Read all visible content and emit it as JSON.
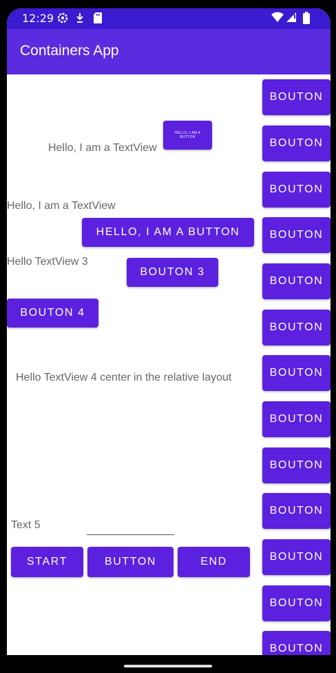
{
  "status_bar": {
    "time": "12:29",
    "left_icons": [
      "settings-gear-icon",
      "download-icon",
      "sd-card-icon"
    ],
    "right_icons": [
      "wifi-icon",
      "signal-icon",
      "battery-icon"
    ]
  },
  "app_bar": {
    "title": "Containers App"
  },
  "views": {
    "small_button": "HELLO, I AM A BUTTON",
    "textview_1": "Hello, I am a TextView",
    "textview_2": "Hello, I am a TextView",
    "hello_button": "HELLO, I AM A BUTTON",
    "textview_3": "Hello TextView 3",
    "bouton_3": "BOUTON 3",
    "bouton_4": "BOUTON 4",
    "textview_4": "Hello TextView 4 center in the relative layout",
    "text_5": "Text 5",
    "edit_text_value": "",
    "start_button": "START",
    "button_button": "BUTTON",
    "end_button": "END"
  },
  "side_buttons": [
    "BOUTON",
    "BOUTON",
    "BOUTON",
    "BOUTON",
    "BOUTON",
    "BOUTON",
    "BOUTON",
    "BOUTON",
    "BOUTON",
    "BOUTON",
    "BOUTON",
    "BOUTON",
    "BOUTON"
  ],
  "colors": {
    "status_bar": "#3B1AD0",
    "app_bar": "#5B2BE0",
    "button": "#5B21DE",
    "text_gray": "#666666"
  }
}
